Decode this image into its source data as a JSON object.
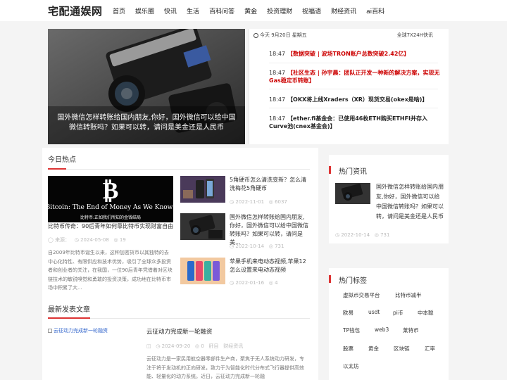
{
  "header": {
    "logo": "宅配通娱网",
    "nav": [
      "首页",
      "娱乐圈",
      "快讯",
      "生活",
      "百科问答",
      "黄金",
      "投资理财",
      "祝福语",
      "财经资讯",
      "ai百科"
    ]
  },
  "hero": {
    "caption": "国外微信怎样转账给国内朋友,你好，国外微信可以给中国微信转账吗？如果可以转，请问是美金还是人民币"
  },
  "flash": {
    "date_label": "今天 9月20日 星期五",
    "more_label": "全球7X24H快讯",
    "items": [
      {
        "time": "18:47",
        "tag": "【数据突破 | 波场TRON账户总数突破2.42亿】",
        "text": ""
      },
      {
        "time": "18:47",
        "tag": "【社区生态 | 孙宇晨：团队正开发一种新的解决方案，实现无Gas稳定币转账】",
        "text": ""
      },
      {
        "time": "18:47",
        "tag": "【OKX将上线Xraders（XR）现货交易(okex是啥)】",
        "text": ""
      },
      {
        "time": "18:47",
        "tag": "【ether.fi基金会：已使用46枚ETH购买ETHFI并存入Curve池(cnex基金会)】",
        "text": ""
      }
    ]
  },
  "hot": {
    "heading": "今日热点",
    "feature": {
      "image_text_big": "Bitcoin: The End of Money As We Know It",
      "image_text_small": "比特币:正如我们所知的金钱结局",
      "title": "比特币传奇：90后青年如何靠比特币实现财富自由",
      "source": "来源：",
      "date": "2024-05-08",
      "views": "19",
      "excerpt": "自2009年比特币诞生以来，这种加密货币以其独特的去中心化特性、有限供应和技术优势，吸引了全球众多投资者和创业者的关注，在我国，一位90后青年凭借着对区块链技术的敏锐嗅觉和勇敢的投资决策，成功地在比特币市场中积累了大..."
    },
    "list": [
      {
        "title": "5角硬币怎么清洗变新？怎么清洗梅花5角硬币",
        "date": "2022-11-01",
        "views": "6037"
      },
      {
        "title": "国外微信怎样转账给国内朋友,你好，国外微信可以给中国微信转账吗？如果可以转，请问是美...",
        "date": "2022-10-14",
        "views": "731"
      },
      {
        "title": "苹果手机来电动态视频,苹果12怎么设置来电动态视频",
        "date": "2022-01-16",
        "views": "4"
      }
    ]
  },
  "latest": {
    "heading": "最新发表文章",
    "image_alt": "云征动力完成新一轮融资",
    "title": "云征动力完成新一轮融资",
    "date": "2024-09-20",
    "views": "0",
    "author": "肝目",
    "category": "财经资讯",
    "excerpt": "云征动力是一家民用航空器零部件生产商，聚焦于无人系统动力研发，专注于将于发动机的正向研发，致力于为智能化时代分布式飞行器提供高效能、轻量化的动力系统。近日，云征动力完成新一轮融"
  },
  "sidebar": {
    "hot_heading": "热门资讯",
    "hot_item": {
      "title": "国外微信怎样转账给国内朋友,你好，国外微信可以给中国微信转账吗？如果可以转，请问是美金还是人民币",
      "date": "2022-10-14",
      "views": "731"
    },
    "tags_heading": "热门标签",
    "tags": [
      "虚拟币交易平台",
      "比特币减半",
      "欧易",
      "usdt",
      "pi币",
      "中本聪",
      "TP钱包",
      "web3",
      "莱特币",
      "股票",
      "黄金",
      "区块链",
      "汇率",
      "以太坊"
    ]
  }
}
